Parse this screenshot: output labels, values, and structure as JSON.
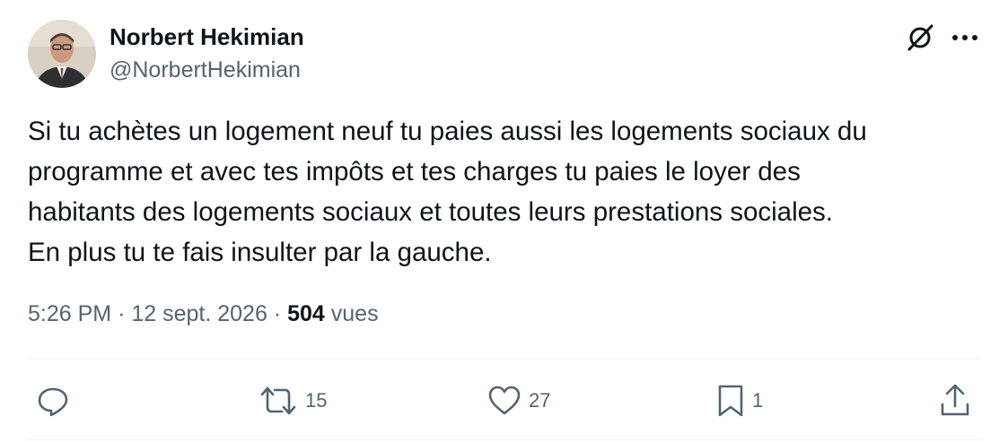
{
  "author": {
    "display_name": "Norbert Hekimian",
    "handle": "@NorbertHekimian",
    "avatar_icon": "profile-photo"
  },
  "header_icons": {
    "grok": "grok-icon",
    "more": "more-icon"
  },
  "tweet": {
    "lines": [
      "Si tu achètes un logement neuf tu paies aussi les logements sociaux du",
      "programme et avec tes impôts et tes charges tu paies le loyer des",
      "habitants des logements sociaux et toutes leurs prestations sociales.",
      "En plus tu te fais insulter par la gauche."
    ]
  },
  "meta": {
    "time": "5:26 PM",
    "separator": "·",
    "date": "12 sept. 2026",
    "views_count": "504",
    "views_label": "vues"
  },
  "actions": {
    "reply": {
      "icon": "reply-icon",
      "count": ""
    },
    "retweet": {
      "icon": "retweet-icon",
      "count": "15"
    },
    "like": {
      "icon": "heart-icon",
      "count": "27"
    },
    "bookmark": {
      "icon": "bookmark-icon",
      "count": "1"
    },
    "share": {
      "icon": "share-icon",
      "count": ""
    }
  },
  "colors": {
    "text_primary": "#0f1419",
    "text_secondary": "#536471",
    "divider": "#eff3f4"
  }
}
